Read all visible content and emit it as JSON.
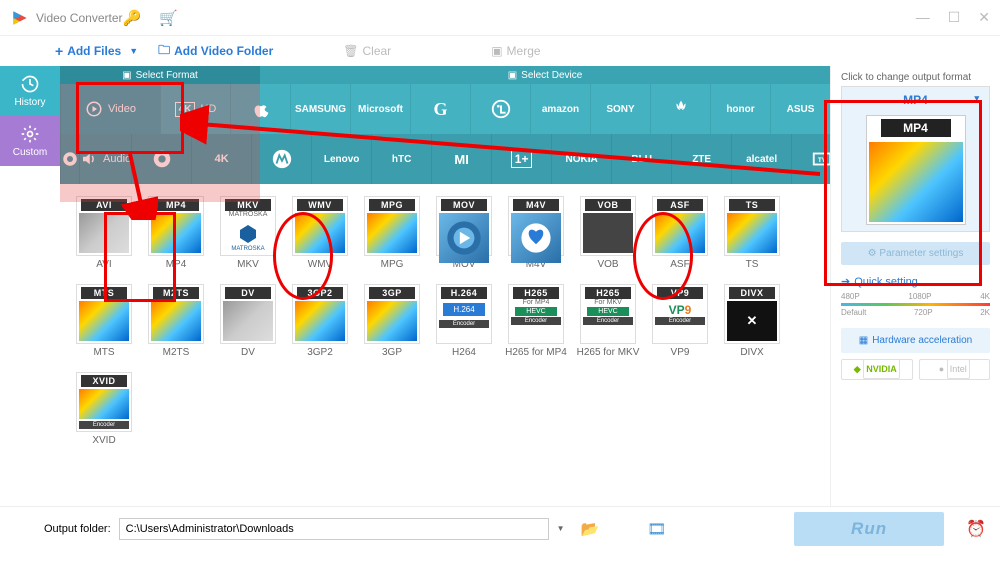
{
  "app": {
    "title": "Video Converter"
  },
  "toolbar": {
    "add_files": "Add Files",
    "add_folder": "Add Video Folder",
    "clear": "Clear",
    "merge": "Merge"
  },
  "leftbar": {
    "history": "History",
    "custom": "Custom"
  },
  "tabs": {
    "format": "Select Format",
    "device": "Select Device"
  },
  "cats": {
    "video": "Video",
    "hd": "HD",
    "audio": "Audio"
  },
  "brands_row1": [
    "apple",
    "samsung",
    "microsoft",
    "google",
    "lg",
    "amazon",
    "sony",
    "huawei",
    "honor",
    "asus"
  ],
  "brands_row1_txt": {
    "samsung": "SAMSUNG",
    "microsoft": "Microsoft",
    "amazon": "amazon",
    "sony": "SONY",
    "huawei": "HUAWEI",
    "honor": "honor",
    "asus": "ASUS"
  },
  "brands_row2": [
    "chrome",
    "4k",
    "motorola",
    "lenovo",
    "htc",
    "xiaomi",
    "oneplus",
    "nokia",
    "blu",
    "zte",
    "alcatel",
    "tv"
  ],
  "brands_row2_txt": {
    "lenovo": "Lenovo",
    "htc": "hTC",
    "nokia": "NOKIA",
    "blu": "BLU",
    "zte": "ZTE",
    "alcatel": "alcatel"
  },
  "formats": [
    {
      "tag": "AVI",
      "label": "AVI",
      "cls": "avi"
    },
    {
      "tag": "MP4",
      "label": "MP4",
      "cls": "mp4"
    },
    {
      "tag": "MKV",
      "label": "MKV",
      "cls": "mkv",
      "sub": "MATROSKA"
    },
    {
      "tag": "WMV",
      "label": "WMV",
      "cls": "wmv"
    },
    {
      "tag": "MPG",
      "label": "MPG",
      "cls": "mpg"
    },
    {
      "tag": "MOV",
      "label": "MOV",
      "cls": "mov"
    },
    {
      "tag": "M4V",
      "label": "M4V",
      "cls": "m4v"
    },
    {
      "tag": "VOB",
      "label": "VOB",
      "cls": "vob"
    },
    {
      "tag": "ASF",
      "label": "ASF",
      "cls": "asf"
    },
    {
      "tag": "TS",
      "label": "TS",
      "cls": "ts"
    },
    {
      "tag": "MTS",
      "label": "MTS",
      "cls": "mts"
    },
    {
      "tag": "M2TS",
      "label": "M2TS",
      "cls": "m2ts"
    },
    {
      "tag": "DV",
      "label": "DV",
      "cls": "dv"
    },
    {
      "tag": "3GP2",
      "label": "3GP2",
      "cls": "gp2"
    },
    {
      "tag": "3GP",
      "label": "3GP",
      "cls": "gp"
    },
    {
      "tag": "H.264",
      "label": "H264",
      "cls": "h264",
      "sub": "H.264",
      "enc": "Encoder"
    },
    {
      "tag": "H265",
      "label": "H265 for MP4",
      "cls": "h265",
      "sub": "For MP4",
      "hevc": "HEVC",
      "enc": "Encoder"
    },
    {
      "tag": "H265",
      "label": "H265 for MKV",
      "cls": "h265",
      "sub": "For MKV",
      "hevc": "HEVC",
      "enc": "Encoder"
    },
    {
      "tag": "VP9",
      "label": "VP9",
      "cls": "vp9",
      "vp": "VP9",
      "enc": "Encoder"
    },
    {
      "tag": "DIVX",
      "label": "DIVX",
      "cls": "divx"
    },
    {
      "tag": "XVID",
      "label": "XVID",
      "cls": "xvid",
      "enc": "Encoder"
    }
  ],
  "right": {
    "title": "Click to change output format",
    "selected": "MP4",
    "preview_tag": "MP4",
    "param": "Parameter settings",
    "quick": "Quick setting",
    "scale_top": [
      "480P",
      "1080P",
      "4K"
    ],
    "scale_bot": [
      "Default",
      "720P",
      "2K"
    ],
    "hw": "Hardware acceleration",
    "nvidia": "NVIDIA",
    "intel": "Intel"
  },
  "footer": {
    "label": "Output folder:",
    "path": "C:\\Users\\Administrator\\Downloads",
    "run": "Run"
  }
}
